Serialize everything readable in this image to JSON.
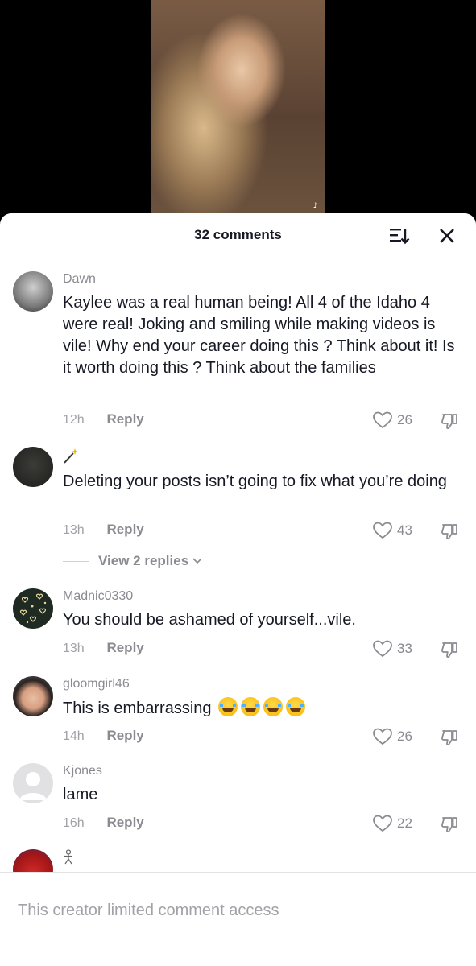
{
  "video": {
    "logo_glyph": "♪"
  },
  "header": {
    "comment_count": "32 comments",
    "sort_icon": "sort-icon",
    "close_icon": "close-icon"
  },
  "comments": [
    {
      "username": "Dawn",
      "text": "Kaylee was a real human being! All 4 of the Idaho 4 were real! Joking and smiling while making videos is vile! Why end your career doing this ? Think about it! Is it worth doing this ? Think about the families",
      "time": "12h",
      "reply_label": "Reply",
      "likes": "26"
    },
    {
      "username_icon": "magic-wand-icon",
      "text": "Deleting your posts isn’t going to fix what you’re doing",
      "time": "13h",
      "reply_label": "Reply",
      "likes": "43",
      "view_replies": "View 2 replies"
    },
    {
      "username": "Madnic0330",
      "text": "You should be ashamed of yourself...vile.",
      "time": "13h",
      "reply_label": "Reply",
      "likes": "33"
    },
    {
      "username": "gloomgirl46",
      "text": "This is embarrassing",
      "emoji": "face-with-tears-of-joy",
      "emoji_count": 4,
      "time": "14h",
      "reply_label": "Reply",
      "likes": "26"
    },
    {
      "username": "Kjones",
      "text": "lame",
      "time": "16h",
      "reply_label": "Reply",
      "likes": "22"
    },
    {
      "username_icon": "stick-figure-icon"
    }
  ],
  "footer": {
    "notice": "This creator limited comment access"
  },
  "colors": {
    "muted": "#8a8b91",
    "text": "#161823",
    "divider": "#e3e3e4"
  }
}
